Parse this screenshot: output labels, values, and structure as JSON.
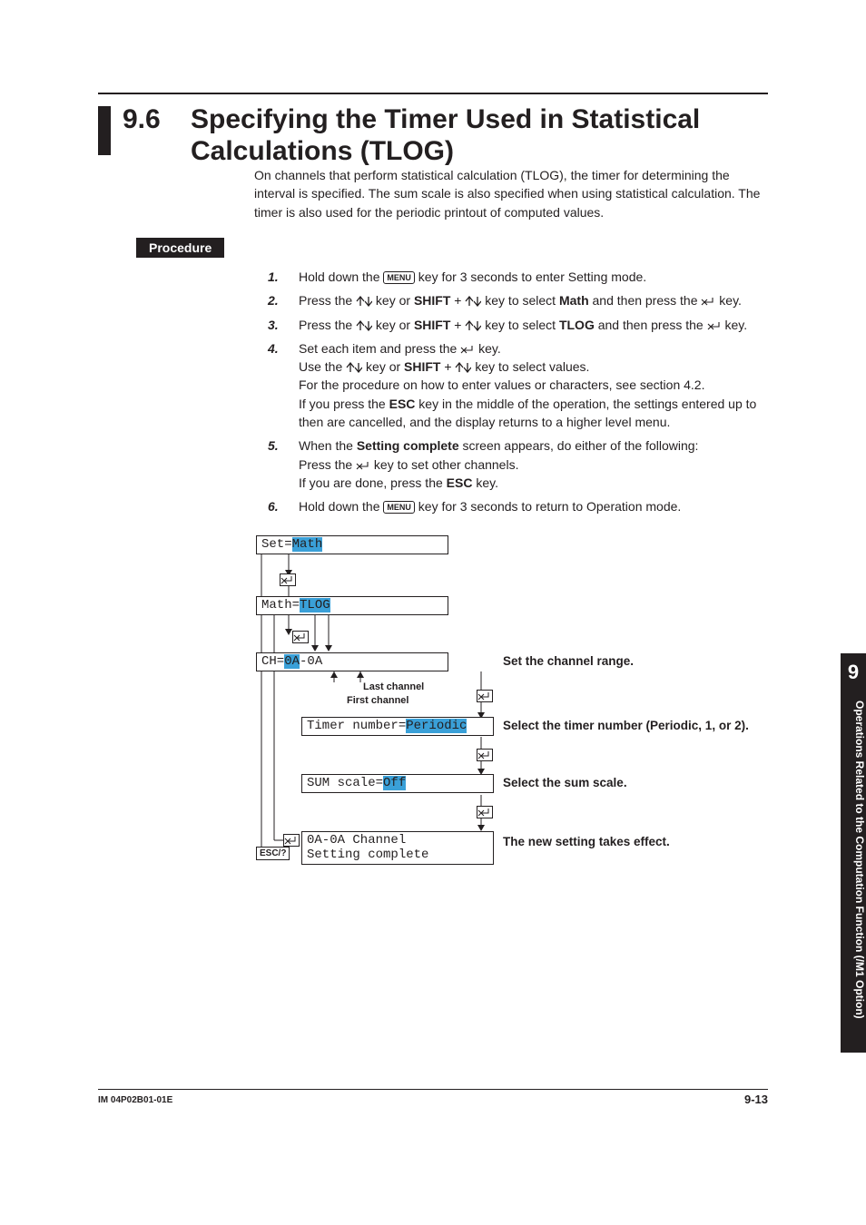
{
  "section": {
    "number": "9.6",
    "title": "Specifying the Timer Used in Statistical Calculations (TLOG)"
  },
  "intro": "On channels that perform statistical calculation (TLOG), the timer for determining the interval is specified. The sum scale is also specified when using statistical calculation. The timer is also used for the periodic printout of computed values.",
  "procedure_label": "Procedure",
  "keys": {
    "menu": "MENU",
    "shift": "SHIFT",
    "esc": "ESC"
  },
  "steps": {
    "s1": {
      "n": "1.",
      "a": "Hold down the ",
      "b": " key for 3 seconds to enter Setting mode."
    },
    "s2": {
      "n": "2.",
      "a": "Press the ",
      "b": " key or ",
      "c": " + ",
      "d": " key to select ",
      "math": "Math",
      "e": " and then press the ",
      "f": " key."
    },
    "s3": {
      "n": "3.",
      "a": "Press the ",
      "b": " key or ",
      "c": " + ",
      "d": " key to select ",
      "tlog": "TLOG",
      "e": " and then press the ",
      "f": " key."
    },
    "s4": {
      "n": "4.",
      "l1a": "Set each item and press the ",
      "l1b": " key.",
      "l2a": "Use the ",
      "l2b": " key or ",
      "l2c": " + ",
      "l2d": " key to select values.",
      "l3": "For the procedure on how to enter values or characters, see section 4.2.",
      "l4a": "If you press the ",
      "l4b": " key in the middle of the operation, the settings entered up to then are cancelled, and the display returns to a higher level menu."
    },
    "s5": {
      "n": "5.",
      "l1a": "When the ",
      "sc": "Setting complete",
      "l1b": " screen appears, do either of the following:",
      "l2a": "Press the ",
      "l2b": " key to set other channels.",
      "l3a": "If you are done, press the ",
      "l3b": " key."
    },
    "s6": {
      "n": "6.",
      "a": "Hold down the ",
      "b": " key for 3 seconds to return to Operation mode."
    }
  },
  "diagram": {
    "box1_a": "Set=",
    "box1_b": "Math",
    "box2_a": "Math=",
    "box2_b": "TLOG",
    "box3_a": "CH=",
    "box3_b": "0A",
    "box3_c": "-0A",
    "last_channel": "Last channel",
    "first_channel": "First channel",
    "box4_a": "Timer number=",
    "box4_b": "Periodic",
    "box5_a": "SUM scale=",
    "box5_b": "Off",
    "box6_l1": "0A-0A Channel",
    "box6_l2": "Setting complete",
    "r1": "Set the channel range.",
    "r2": "Select the timer number (Periodic, 1, or 2).",
    "r3": "Select the sum scale.",
    "r4": "The new setting takes effect.",
    "esc": "ESC/?"
  },
  "sidetab": {
    "num": "9",
    "text": "Operations Related to the Computation Function (/M1 Option)"
  },
  "footer": {
    "left": "IM 04P02B01-01E",
    "right": "9-13"
  }
}
